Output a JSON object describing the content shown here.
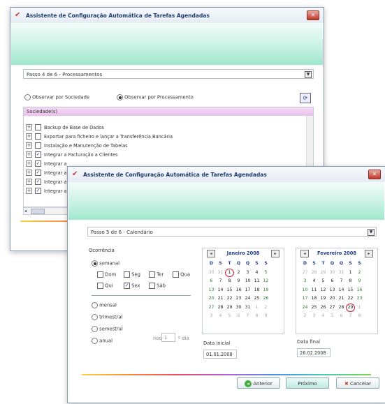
{
  "back_window": {
    "title": "Assistente de Configuração Automática de Tarefas Agendadas",
    "step_label": "Passo 4 de 6 - Processamentos",
    "radio_sociedade": "Observar por Sociedade",
    "radio_processamento": "Observar por Processamento",
    "list_header": "Sociedade(s)",
    "list_items": [
      {
        "label": "Backup de Base de Dados",
        "checked": false
      },
      {
        "label": "Exportar para ficheiro e lançar a Transferência Bancária",
        "checked": false
      },
      {
        "label": "Instalação e Manutenção de Tabelas",
        "checked": false
      },
      {
        "label": "Integrar a Facturação a Clientes",
        "checked": true
      },
      {
        "label": "Integrar a",
        "checked": true
      },
      {
        "label": "Integrar a",
        "checked": true
      },
      {
        "label": "Integrar a",
        "checked": true
      },
      {
        "label": "Integrar a",
        "checked": true
      }
    ]
  },
  "front_window": {
    "title": "Assistente de Configuração Automática de Tarefas Agendadas",
    "step_label": "Passo 5 de 6 - Calendário",
    "occurrence_label": "Ocorrência",
    "options": {
      "semanal": "semanal",
      "mensal": "mensal",
      "trimestral": "trimestral",
      "semestral": "semestral",
      "anual": "anual"
    },
    "weekdays": [
      {
        "label": "Dom",
        "checked": false
      },
      {
        "label": "Seg",
        "checked": false
      },
      {
        "label": "Ter",
        "checked": false
      },
      {
        "label": "Qua",
        "checked": false
      },
      {
        "label": "Qui",
        "checked": false
      },
      {
        "label": "Sex",
        "checked": true
      },
      {
        "label": "Sáb",
        "checked": false
      }
    ],
    "every_prefix": "nos",
    "every_value": "1",
    "every_suffix": "º dia",
    "calendar1": {
      "month": "Janeiro 2008",
      "day_headers": [
        "D",
        "S",
        "T",
        "Q",
        "Q",
        "S",
        "S"
      ],
      "weeks": [
        [
          "30",
          "31",
          "1",
          "2",
          "3",
          "4",
          "5"
        ],
        [
          "6",
          "7",
          "8",
          "9",
          "10",
          "11",
          "12"
        ],
        [
          "13",
          "14",
          "15",
          "16",
          "17",
          "18",
          "19"
        ],
        [
          "20",
          "21",
          "22",
          "23",
          "24",
          "25",
          "26"
        ],
        [
          "27",
          "28",
          "29",
          "30",
          "31",
          "1",
          "2"
        ],
        [
          "3",
          "4",
          "5",
          "6",
          "7",
          "8",
          "9"
        ]
      ]
    },
    "calendar2": {
      "month": "Fevereiro 2008",
      "day_headers": [
        "D",
        "S",
        "T",
        "Q",
        "Q",
        "S",
        "S"
      ],
      "weeks": [
        [
          "27",
          "28",
          "29",
          "30",
          "31",
          "1",
          "2"
        ],
        [
          "3",
          "4",
          "5",
          "6",
          "7",
          "8",
          "9"
        ],
        [
          "10",
          "11",
          "12",
          "13",
          "14",
          "15",
          "16"
        ],
        [
          "17",
          "18",
          "19",
          "20",
          "21",
          "22",
          "23"
        ],
        [
          "24",
          "25",
          "26",
          "27",
          "28",
          "29",
          "1"
        ],
        [
          "2",
          "3",
          "4",
          "5",
          "6",
          "7",
          "8"
        ]
      ]
    },
    "start_label": "Data inicial",
    "start_value": "01.01.2008",
    "end_label": "Data final",
    "end_value": "26.02.2008",
    "btn_back": "Anterior",
    "btn_next": "Próximo",
    "btn_cancel": "Cancelar"
  },
  "colors": {
    "accent_green": "#9fe6cd",
    "title_blue": "#1f3c6e",
    "selected_red": "#d0213a"
  }
}
